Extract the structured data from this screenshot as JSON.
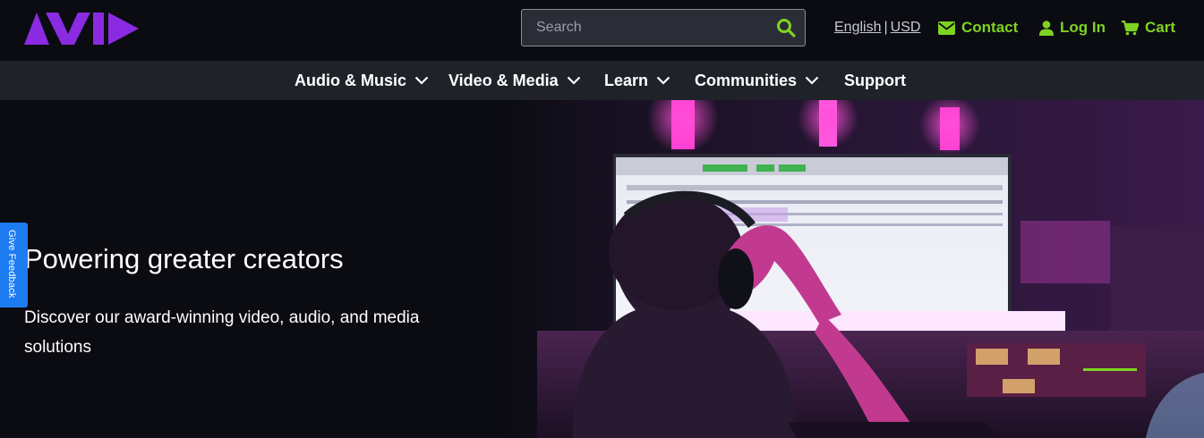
{
  "brand": {
    "logo_alt": "AVID",
    "logo_color": "#8a2be2"
  },
  "search": {
    "placeholder": "Search",
    "icon": "search-icon"
  },
  "locale": {
    "language": "English",
    "separator": "|",
    "currency": "USD"
  },
  "utility": {
    "contact": "Contact",
    "login": "Log In",
    "cart": "Cart",
    "accent": "#7ed321"
  },
  "nav": {
    "items": [
      {
        "label": "Audio & Music",
        "dropdown": true
      },
      {
        "label": "Video & Media",
        "dropdown": true
      },
      {
        "label": "Learn",
        "dropdown": true
      },
      {
        "label": "Communities",
        "dropdown": true
      },
      {
        "label": "Support",
        "dropdown": false
      }
    ]
  },
  "hero": {
    "title": "Powering greater creators",
    "subtitle": "Discover our award-winning video, audio, and media solutions",
    "image": "recording-studio-photo"
  },
  "feedback": {
    "label": "Give Feedback",
    "color": "#1d7cf2"
  }
}
